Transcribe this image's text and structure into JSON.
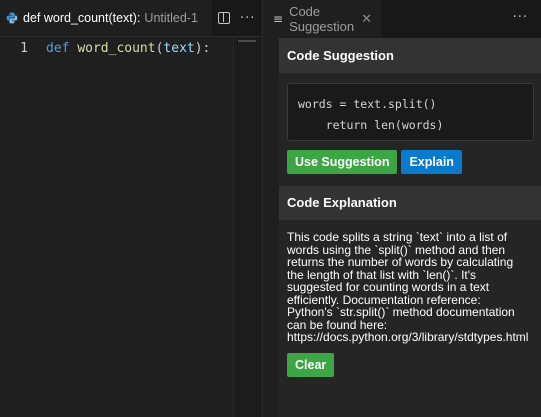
{
  "editor": {
    "tab_title": "def word_count(text):",
    "tab_subtitle": "Untitled-1",
    "line_number": "1",
    "code": {
      "keyword": "def",
      "function": "word_count",
      "open_paren": "(",
      "param": "text",
      "close": "):"
    }
  },
  "panel": {
    "tab_label": "Code Suggestion",
    "suggestion": {
      "header": "Code Suggestion",
      "code": "words = text.split()\n    return len(words)",
      "use_button": "Use Suggestion",
      "explain_button": "Explain"
    },
    "explanation": {
      "header": "Code Explanation",
      "lines": [
        "This code splits a string `text` into a list of",
        "words using the `split()` method and then",
        "returns the number of words by calculating",
        "the length of that list with `len()`. It's",
        "suggested for counting words in a text",
        "efficiently. Documentation reference:",
        "Python's `str.split()` method documentation",
        "can be found here:",
        "https://docs.python.org/3/library/stdtypes.html"
      ],
      "clear_button": "Clear"
    }
  },
  "colors": {
    "accent_green": "#3ca544",
    "accent_blue": "#0a7acd",
    "background": "#1f1f1f"
  },
  "icons": [
    "python-file-icon",
    "split-editor-icon",
    "more-actions-icon",
    "document-icon",
    "close-icon"
  ]
}
